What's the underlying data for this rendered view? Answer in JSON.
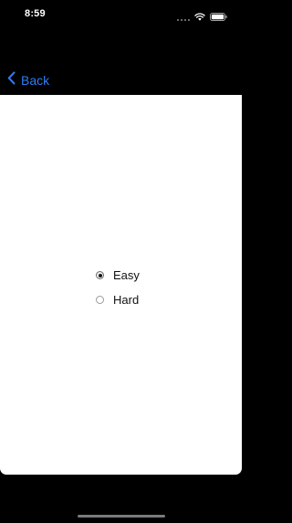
{
  "status_bar": {
    "time": "8:59",
    "icons": [
      "cellular-dots-icon",
      "wifi-icon",
      "battery-icon"
    ]
  },
  "nav": {
    "back_label": "Back",
    "back_icon": "chevron-left-icon",
    "accent_color": "#2f7cf6"
  },
  "radio_group": {
    "options": [
      {
        "label": "Easy",
        "selected": true
      },
      {
        "label": "Hard",
        "selected": false
      }
    ]
  }
}
